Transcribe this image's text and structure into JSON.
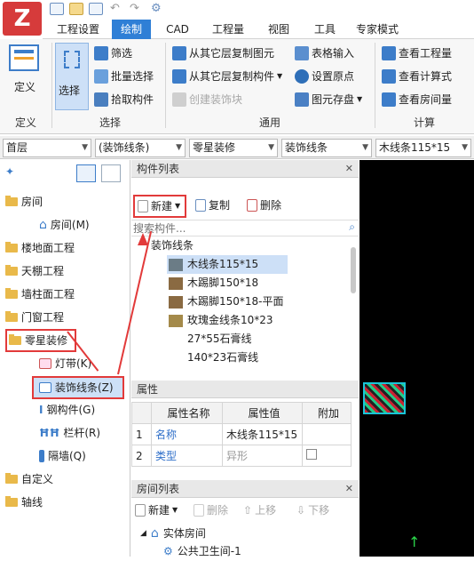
{
  "app": {
    "logo": "Z"
  },
  "tabs": [
    "工程设置",
    "绘制",
    "CAD",
    "工程量",
    "视图",
    "工具",
    "专家模式"
  ],
  "active_tab": 1,
  "ribbon": {
    "groups": [
      "定义",
      "选择",
      "通用",
      "计算"
    ],
    "define": {
      "label": "定义"
    },
    "select": {
      "select_label": "选择",
      "filter": "筛选",
      "batch_select": "批量选择",
      "pick": "拾取构件"
    },
    "common": {
      "copy_elem": "从其它层复制图元",
      "copy_comp": "从其它层复制构件",
      "create_deco": "创建装饰块",
      "table_input": "表格输入",
      "set_origin": "设置原点",
      "save_elem": "图元存盘"
    },
    "calc": {
      "view_qty": "查看工程量",
      "view_formula": "查看计算式",
      "view_room_qty": "查看房间量"
    }
  },
  "combos": [
    "首层",
    "(装饰线条)",
    "零星装修",
    "装饰线条",
    "木线条115*15"
  ],
  "tree": {
    "items": [
      "房间",
      "房间(M)",
      "楼地面工程",
      "天棚工程",
      "墙柱面工程",
      "门窗工程",
      "零星装修",
      "灯带(K)",
      "装饰线条(Z)",
      "钢构件(G)",
      "栏杆(R)",
      "隔墙(Q)",
      "自定义",
      "轴线"
    ]
  },
  "component_list": {
    "title": "构件列表",
    "new": "新建",
    "copy": "复制",
    "delete": "删除",
    "search_placeholder": "搜索构件...",
    "category": "装饰线条",
    "items": [
      "木线条115*15",
      "木踢脚150*18",
      "木踢脚150*18-平面",
      "玫瑰金线条10*23",
      "27*55石膏线",
      "140*23石膏线"
    ]
  },
  "properties": {
    "title": "属性",
    "headers": [
      "属性名称",
      "属性值",
      "附加"
    ],
    "rows": [
      {
        "n": "1",
        "name": "名称",
        "value": "木线条115*15"
      },
      {
        "n": "2",
        "name": "类型",
        "value": "异形"
      }
    ]
  },
  "room_list": {
    "title": "房间列表",
    "new": "新建",
    "delete": "删除",
    "up": "上移",
    "down": "下移",
    "root": "实体房间",
    "child": "公共卫生间-1"
  }
}
